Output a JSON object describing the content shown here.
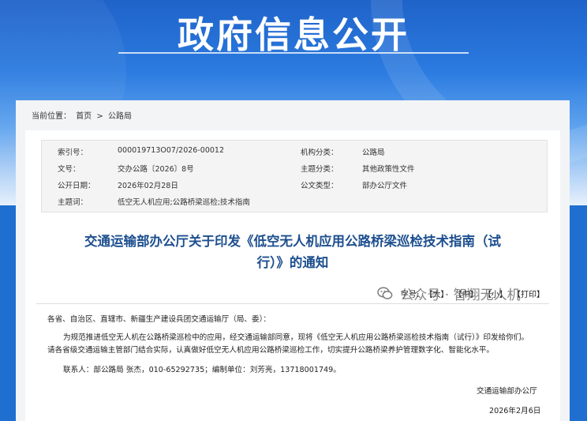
{
  "header": {
    "title": "政府信息公开"
  },
  "breadcrumb": {
    "prefix": "当前位置：",
    "home": "首页",
    "sep": ">",
    "current": "公路局"
  },
  "meta": {
    "index_label": "索引号：",
    "index_value": "000019713O07/2026-00012",
    "org_label": "机构分类：",
    "org_value": "公路局",
    "docno_label": "文号：",
    "docno_value": "交办公路〔2026〕8号",
    "topic_label": "主题分类：",
    "topic_value": "其他政策性文件",
    "date_label": "公开日期：",
    "date_value": "2026年02月28日",
    "type_label": "公文类型：",
    "type_value": "部办公厅文件",
    "keywords_label": "主题词：",
    "keywords_value": "低空无人机应用;公路桥梁巡检;技术指南"
  },
  "document": {
    "title_line1": "交通运输部办公厅关于印发《低空无人机应用公路桥梁巡检技术指南（试",
    "title_line2": "行）》的通知",
    "font_label": "字号:",
    "font_large": "【大】",
    "font_medium": "【中】",
    "font_small": "【小】",
    "print": "【打印】",
    "salutation": "各省、自治区、直辖市、新疆生产建设兵团交通运输厅（局、委）：",
    "para1_line1": "为规范推进低空无人机在公路桥梁巡检中的应用，经交通运输部同意，现将《低空无人机应用公路桥梁巡检技术指南（试行）》印发给你们。",
    "para1_line2": "请各省级交通运输主管部门结合实际，认真做好低空无人机应用公路桥梁巡检工作，切实提升公路桥梁养护管理数字化、智能化水平。",
    "contact": "联系人：部公路局 张杰，010-65292735；编制单位：刘芳亮，13718001749。",
    "signature": "交通运输部办公厅",
    "sign_date": "2026年2月6日"
  },
  "watermark": {
    "text": "公众号 · 智翔无人机"
  }
}
